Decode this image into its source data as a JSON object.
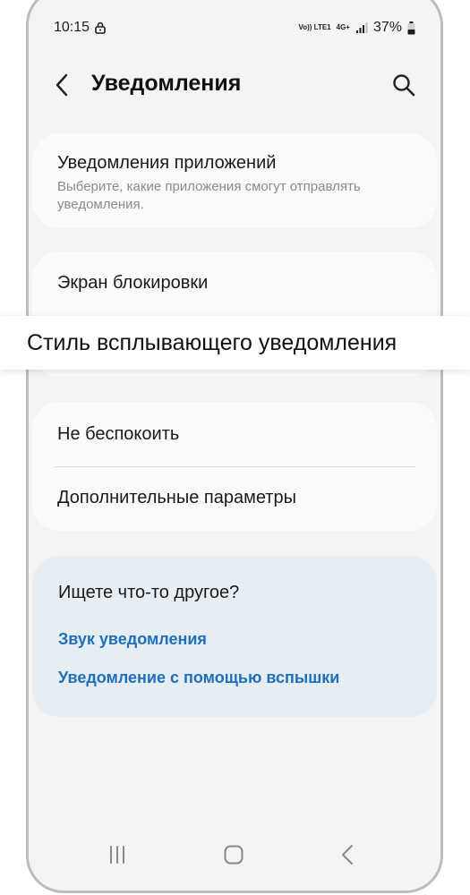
{
  "status_bar": {
    "time": "10:15",
    "volte_label": "Vo)) LTE1",
    "net_label": "4G+",
    "battery": "37%"
  },
  "header": {
    "title": "Уведомления"
  },
  "section1": {
    "title": "Уведомления приложений",
    "subtitle": "Выберите, какие приложения смогут отправлять уведомления."
  },
  "section2": {
    "item1": "Экран блокировки"
  },
  "tooltip": {
    "text": "Стиль всплывающего уведомления"
  },
  "section3": {
    "item1": "Не беспокоить",
    "item2": "Дополнительные параметры"
  },
  "suggest": {
    "title": "Ищете что-то другое?",
    "links": [
      "Звук уведомления",
      "Уведомление с помощью вспышки"
    ]
  },
  "colors": {
    "link": "#1f6fbc",
    "suggest_bg": "#e6edf3"
  }
}
